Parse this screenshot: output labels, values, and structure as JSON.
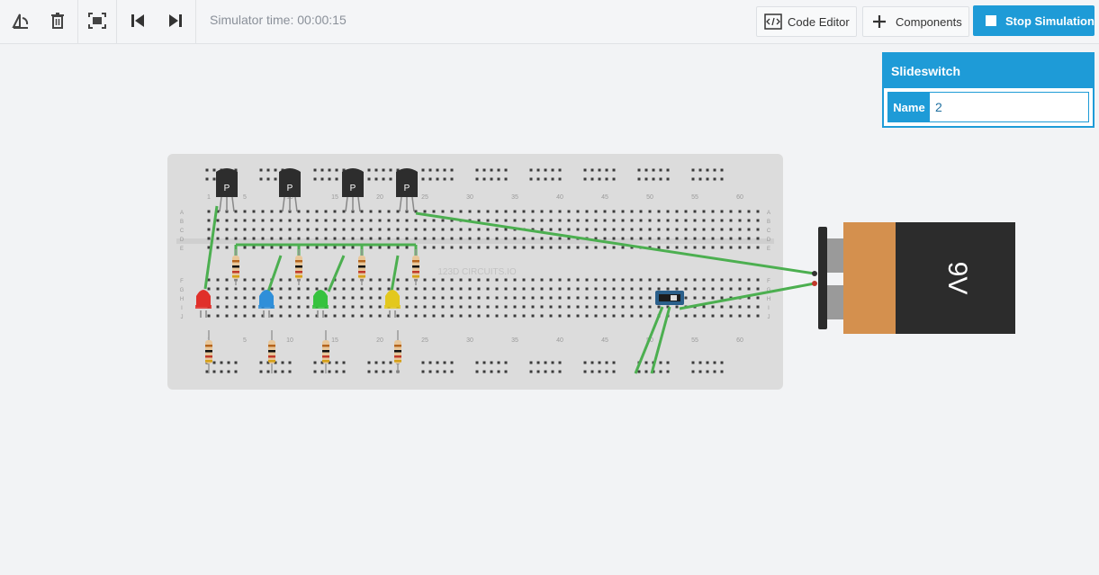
{
  "toolbar": {
    "icons": [
      "rotate-icon",
      "trash-icon",
      "fit-view-icon",
      "step-back-icon",
      "step-forward-icon"
    ],
    "sim_time": "Simulator time: 00:00:15",
    "code_editor_label": "Code Editor",
    "components_label": "Components",
    "stop_label": "Stop Simulation"
  },
  "inspector": {
    "title": "Slideswitch",
    "name_key": "Name",
    "name_value": "2"
  },
  "breadboard": {
    "top_columns": [
      "1",
      "5",
      "10",
      "15",
      "20",
      "25",
      "30",
      "35",
      "40",
      "45",
      "50",
      "55",
      "60"
    ],
    "rows_left": [
      "A",
      "B",
      "C",
      "D",
      "E",
      "F",
      "G",
      "H",
      "I",
      "J"
    ],
    "brand": "123D CIRCUITS.IO",
    "transistor_label": "P"
  },
  "battery": {
    "label": "9V"
  },
  "colors": {
    "accent": "#1e9bd7",
    "wire": "#4caf50",
    "led_red": "#e0302a",
    "led_blue": "#2f8fd9",
    "led_green": "#36c23e",
    "led_yellow": "#e3c81e"
  }
}
